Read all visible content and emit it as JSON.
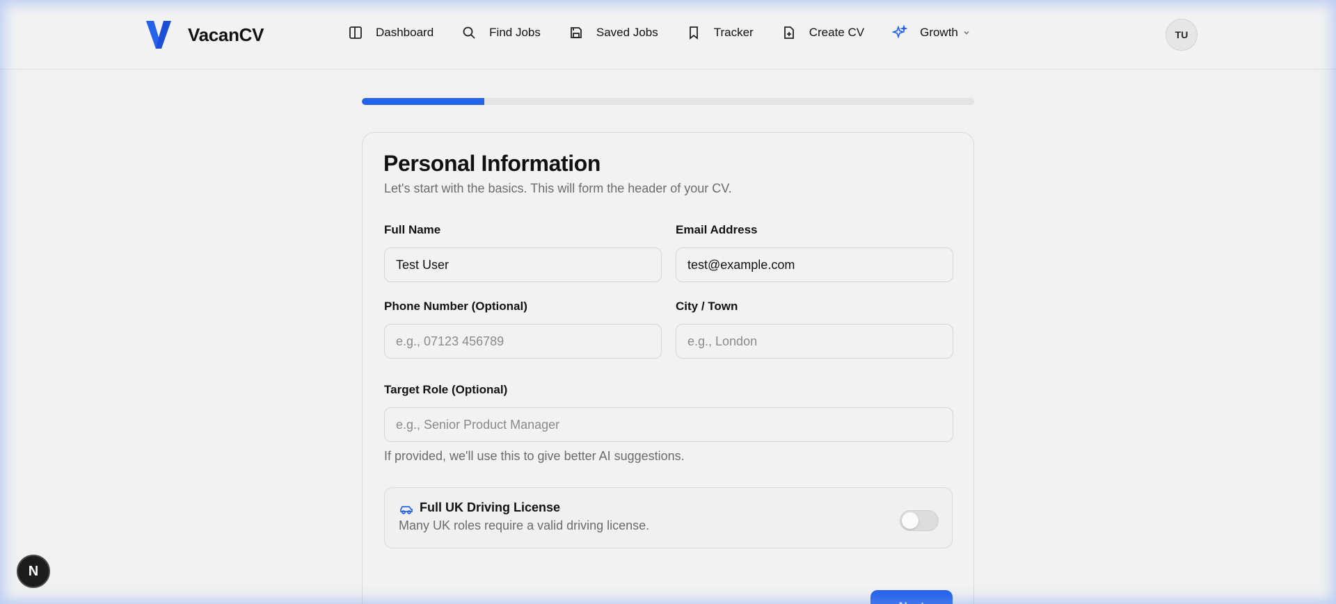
{
  "app": {
    "name": "VacanCV",
    "brand_color": "#2563eb"
  },
  "nav": {
    "items": [
      {
        "label": "Dashboard",
        "icon": "layout-panel-icon"
      },
      {
        "label": "Find Jobs",
        "icon": "search-icon"
      },
      {
        "label": "Saved Jobs",
        "icon": "save-icon"
      },
      {
        "label": "Tracker",
        "icon": "bookmark-icon"
      },
      {
        "label": "Create CV",
        "icon": "file-plus-icon"
      },
      {
        "label": "Growth",
        "icon": "sparkles-icon"
      }
    ]
  },
  "user": {
    "initials": "TU"
  },
  "progress": {
    "fraction": 0.2
  },
  "form": {
    "title": "Personal Information",
    "subtitle": "Let's start with the basics. This will form the header of your CV.",
    "full_name": {
      "label": "Full Name",
      "value": "Test User"
    },
    "email": {
      "label": "Email Address",
      "value": "test@example.com"
    },
    "phone": {
      "label": "Phone Number (Optional)",
      "placeholder": "e.g., 07123 456789"
    },
    "city": {
      "label": "City / Town",
      "placeholder": "e.g., London"
    },
    "target_role": {
      "label": "Target Role (Optional)",
      "placeholder": "e.g., Senior Product Manager",
      "hint": "If provided, we'll use this to give better AI suggestions."
    },
    "license": {
      "title": "Full UK Driving License",
      "description": "Many UK roles require a valid driving license.",
      "enabled": false
    },
    "next_label": "Next"
  },
  "dev_badge": {
    "label": "N"
  }
}
